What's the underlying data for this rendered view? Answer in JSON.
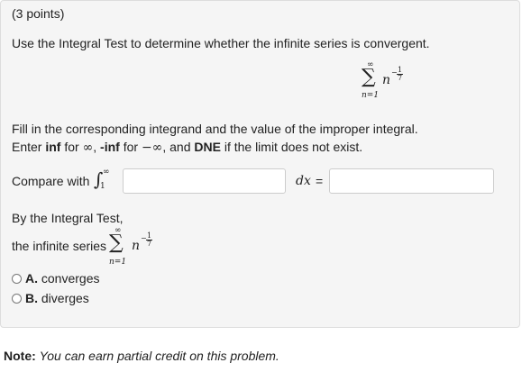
{
  "points": "(3 points)",
  "instruction": "Use the Integral Test to determine whether the infinite series is convergent.",
  "series": {
    "sum_symbol": "∑",
    "upper": "∞",
    "lower": "n=1",
    "term": "n",
    "exp_sign": "−",
    "exp_num": "1",
    "exp_den": "7"
  },
  "fill_instructions": {
    "line1": "Fill in the corresponding integrand and the value of the improper integral.",
    "enter": "Enter ",
    "inf": "inf",
    "for1": " for ",
    "inf_sym": "∞",
    "comma1": ", ",
    "neg_inf": "-inf",
    "for2": " for ",
    "neg_inf_sym": "−∞",
    "and": ", and ",
    "dne": "DNE",
    "tail": " if the limit does not exist."
  },
  "compare": {
    "label": "Compare with",
    "integral_sign": "∫",
    "lower": "1",
    "upper": "∞",
    "dx": "dx",
    "equals": "=",
    "integrand_value": "",
    "integral_value": ""
  },
  "integral_test": {
    "by_label": "By the Integral Test,",
    "series_label": "the infinite series"
  },
  "options": [
    {
      "letter": "A.",
      "text": "converges"
    },
    {
      "letter": "B.",
      "text": "diverges"
    }
  ],
  "note": {
    "label": "Note:",
    "text": "You can earn partial credit on this problem."
  }
}
